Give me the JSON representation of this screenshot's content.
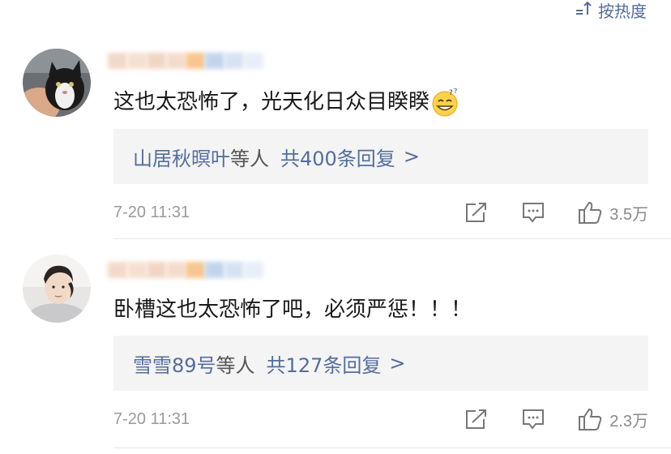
{
  "sort": {
    "label": "按热度",
    "icon": "sort-icon"
  },
  "comments": [
    {
      "text": "这也太恐怖了，光天化日众目睽睽",
      "emoji": "dizzy-grin-emoji",
      "reply_names": "山居秋暝叶",
      "reply_etc": "等人",
      "reply_count": "共400条回复",
      "reply_arrow": ">",
      "timestamp": "7-20 11:31",
      "likes": "3.5万"
    },
    {
      "text": "卧槽这也太恐怖了吧，必须严惩！！！",
      "reply_names": "雪雪89号",
      "reply_etc": "等人",
      "reply_count": "共127条回复",
      "reply_arrow": ">",
      "timestamp": "7-20 11:31",
      "likes": "2.3万"
    }
  ],
  "colors": {
    "link": "#526d9e",
    "reply_bg": "#f4f4f4",
    "muted": "#9a9a9a"
  }
}
